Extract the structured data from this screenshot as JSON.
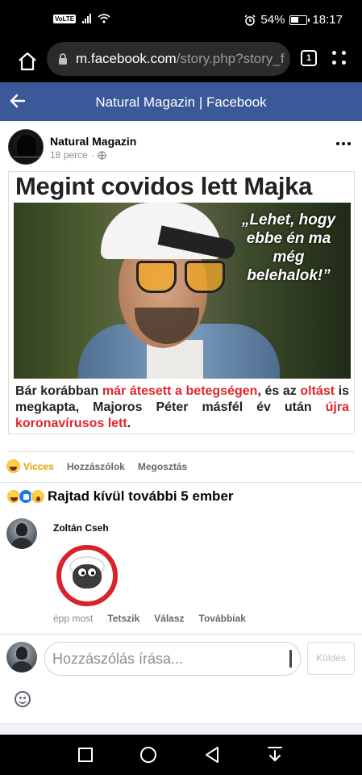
{
  "status_bar": {
    "volte": "VoLTE",
    "battery_percent": "54%",
    "battery_level": 0.54,
    "time": "18:17"
  },
  "browser": {
    "url_host": "m.facebook.com",
    "url_path": "/story.php?story_f",
    "tab_count": "1"
  },
  "header": {
    "title": "Natural Magazin | Facebook"
  },
  "post": {
    "author": "Natural Magazin",
    "time": "18 perce",
    "dot": "·",
    "image": {
      "headline": "Megint covidos lett Majka",
      "quote": "„Lehet, hogy ebbe én ma még belehalok!”",
      "caption": {
        "p1": "Bár korábban ",
        "p2": "már átesett a betegségen",
        "p3": ", és az ",
        "p4": "oltást",
        "p5": " is megkapta, Majoros Péter másfél év után ",
        "p6": "újra koronavírusos lett",
        "p7": "."
      }
    }
  },
  "reactions": {
    "current": "Vicces",
    "comment": "Hozzászólok",
    "share": "Megosztás",
    "summary": "Rajtad kívül további 5 ember"
  },
  "comment": {
    "author": "Zoltán Cseh",
    "time": "épp most",
    "like": "Tetszik",
    "reply": "Válasz",
    "more": "Továbbiak"
  },
  "composer": {
    "placeholder": "Hozzászólás írása...",
    "send": "Küldés"
  },
  "colors": {
    "fb_blue": "#3b5998",
    "headline_red": "#e0262c",
    "haha_yellow": "#e5a400"
  }
}
